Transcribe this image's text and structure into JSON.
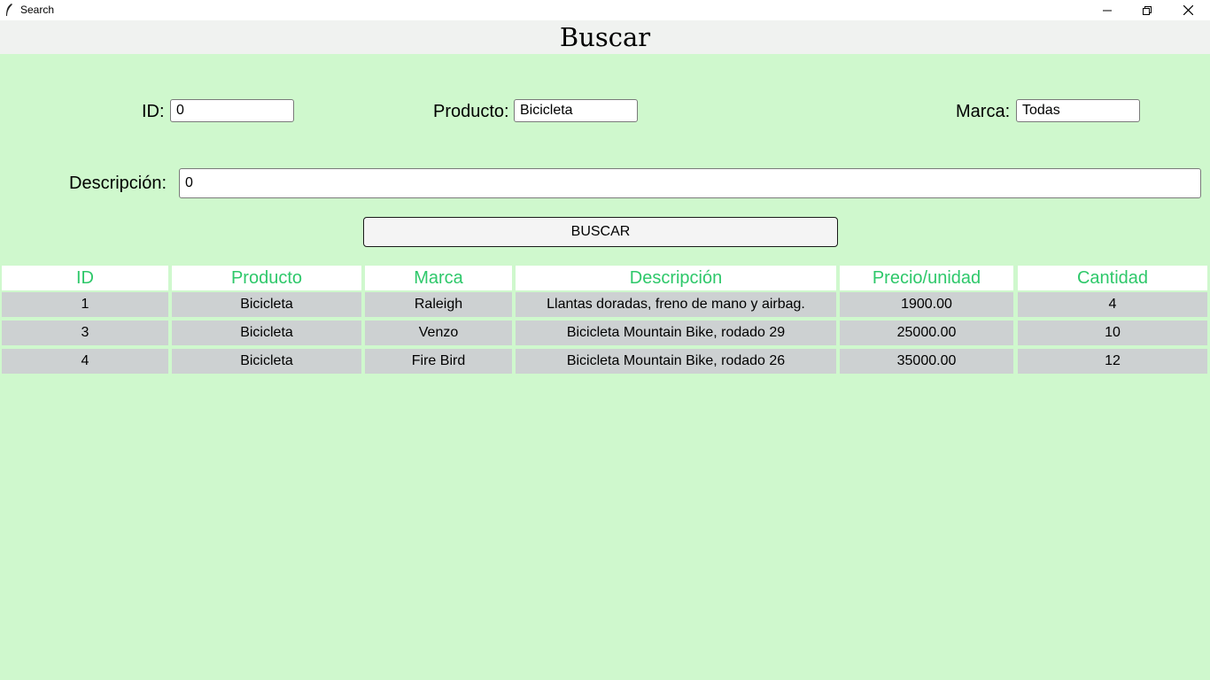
{
  "window": {
    "title": "Search"
  },
  "page": {
    "title": "Buscar"
  },
  "form": {
    "id_label": "ID:",
    "id_value": "0",
    "producto_label": "Producto:",
    "producto_value": "Bicicleta",
    "marca_label": "Marca:",
    "marca_value": "Todas",
    "descripcion_label": "Descripción:",
    "descripcion_value": "0",
    "search_button": "BUSCAR"
  },
  "table": {
    "columns": [
      "ID",
      "Producto",
      "Marca",
      "Descripción",
      "Precio/unidad",
      "Cantidad"
    ],
    "rows": [
      [
        "1",
        "Bicicleta",
        "Raleigh",
        "Llantas doradas, freno de mano y airbag.",
        "1900.00",
        "4"
      ],
      [
        "3",
        "Bicicleta",
        "Venzo",
        "Bicicleta Mountain Bike, rodado 29",
        "25000.00",
        "10"
      ],
      [
        "4",
        "Bicicleta",
        "Fire Bird",
        "Bicicleta Mountain Bike, rodado 26",
        "35000.00",
        "12"
      ]
    ]
  },
  "colors": {
    "background": "#cff8cd",
    "header_text": "#2ec86a",
    "row_background": "#cdd1d2"
  }
}
